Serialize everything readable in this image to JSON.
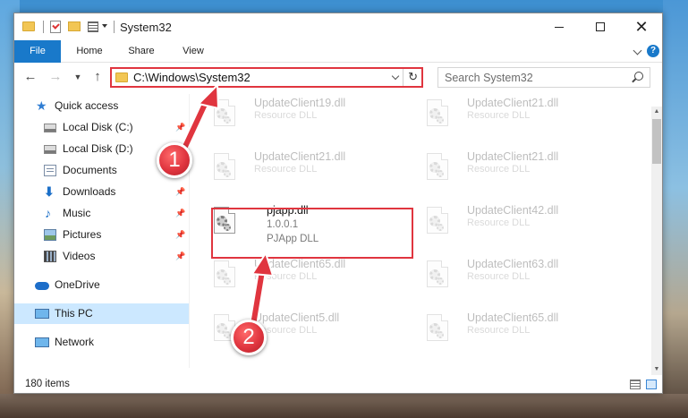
{
  "window": {
    "title": "System32"
  },
  "ribbon": {
    "tabs": [
      "File",
      "Home",
      "Share",
      "View"
    ]
  },
  "address": {
    "path": "C:\\Windows\\System32"
  },
  "search": {
    "placeholder": "Search System32"
  },
  "sidebar": {
    "items": [
      {
        "label": "Quick access",
        "icon": "star-icon"
      },
      {
        "label": "Local Disk (C:)",
        "icon": "drive-icon",
        "pinned": true
      },
      {
        "label": "Local Disk (D:)",
        "icon": "drive-icon",
        "pinned": false
      },
      {
        "label": "Documents",
        "icon": "documents-icon",
        "pinned": true
      },
      {
        "label": "Downloads",
        "icon": "download-icon",
        "pinned": true
      },
      {
        "label": "Music",
        "icon": "music-icon",
        "pinned": true
      },
      {
        "label": "Pictures",
        "icon": "pictures-icon",
        "pinned": true
      },
      {
        "label": "Videos",
        "icon": "videos-icon",
        "pinned": true
      },
      {
        "label": "OneDrive",
        "icon": "onedrive-icon"
      },
      {
        "label": "This PC",
        "icon": "computer-icon",
        "selected": true
      },
      {
        "label": "Network",
        "icon": "network-icon"
      }
    ]
  },
  "files": [
    {
      "name": "UpdateClient19.dll",
      "type": "Resource DLL"
    },
    {
      "name": "UpdateClient21.dll",
      "type": "Resource DLL"
    },
    {
      "name": "UpdateClient21.dll",
      "type": "Resource DLL"
    },
    {
      "name": "UpdateClient21.dll",
      "type": "Resource DLL"
    },
    {
      "name": "pjapp.dll",
      "version": "1.0.0.1",
      "type": "PJApp DLL",
      "highlighted": true
    },
    {
      "name": "UpdateClient42.dll",
      "type": "Resource DLL"
    },
    {
      "name": "UpdateClient65.dll",
      "type": "Resource DLL"
    },
    {
      "name": "UpdateClient63.dll",
      "type": "Resource DLL"
    },
    {
      "name": "UpdateClient5.dll",
      "type": "Resource DLL"
    },
    {
      "name": "UpdateClient65.dll",
      "type": "Resource DLL"
    }
  ],
  "status": {
    "item_count": "180 items"
  },
  "annotations": {
    "step1": "1",
    "step2": "2"
  },
  "colors": {
    "accent": "#1979ca",
    "highlight": "#e0353f",
    "selection": "#cce8ff"
  }
}
